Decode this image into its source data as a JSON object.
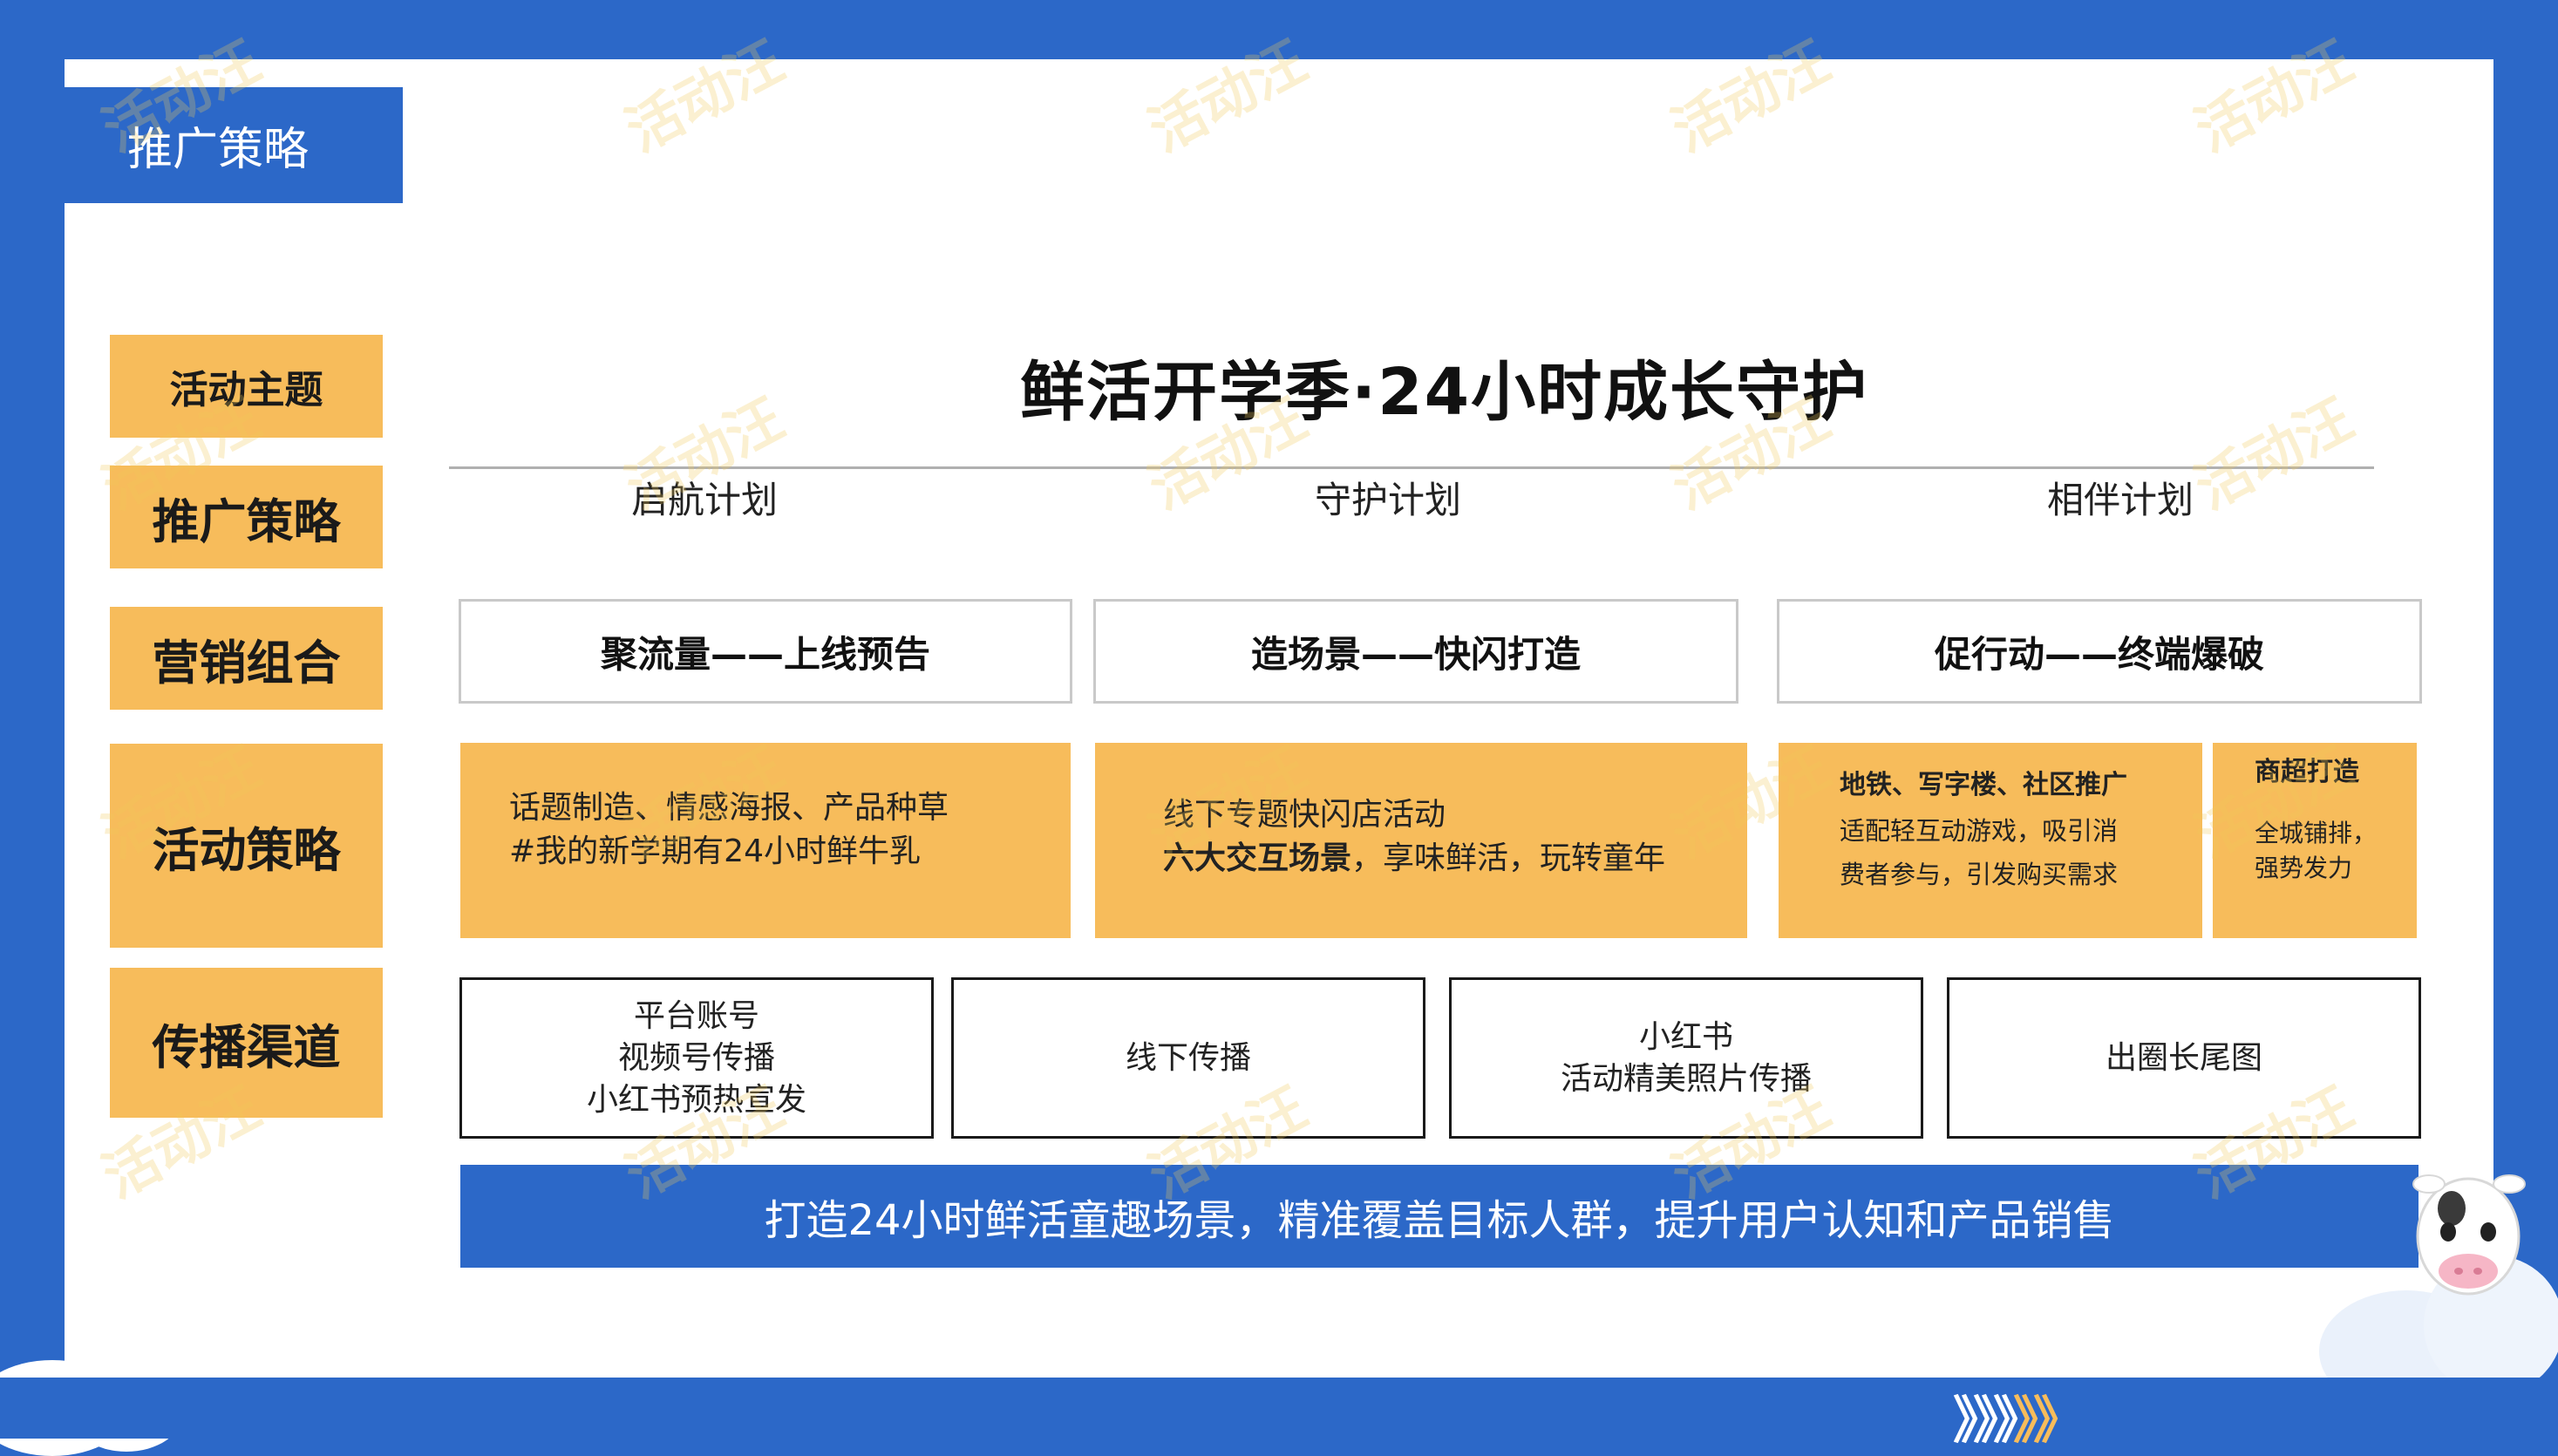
{
  "header": {
    "title": "推广策略"
  },
  "side_labels": [
    "活动主题",
    "推广策略",
    "营销组合",
    "活动策略",
    "传播渠道"
  ],
  "theme": {
    "title": "鲜活开学季·24小时成长守护"
  },
  "plans": [
    "启航计划",
    "守护计划",
    "相伴计划"
  ],
  "marketing": [
    "聚流量——上线预告",
    "造场景——快闪打造",
    "促行动——终端爆破"
  ],
  "activities": {
    "a1": {
      "line1": "话题制造、情感海报、产品种草",
      "line2": "#我的新学期有24小时鲜牛乳"
    },
    "a2": {
      "line1": "线下专题快闪店活动",
      "line2_bold": "六大交互场景",
      "line2_rest": "，享味鲜活，玩转童年"
    },
    "a3": {
      "title": "地铁、写字楼、社区推广",
      "line1": "适配轻互动游戏，吸引消",
      "line2": "费者参与，引发购买需求"
    },
    "a4": {
      "title": "商超打造",
      "line1": "全城铺排，",
      "line2": "强势发力"
    }
  },
  "channels": {
    "c1": [
      "平台账号",
      "视频号传播",
      "小红书预热宣发"
    ],
    "c2": [
      "线下传播"
    ],
    "c3": [
      "小红书",
      "活动精美照片传播"
    ],
    "c4": [
      "出圈长尾图"
    ]
  },
  "banner": {
    "text": "打造24小时鲜活童趣场景，精准覆盖目标人群，提升用户认知和产品销售"
  },
  "decor": {
    "chevrons": "》》》》》",
    "watermark": "活动汪",
    "colors": {
      "blue": "#2c68c8",
      "orange": "#f7bc5b",
      "white": "#ffffff"
    }
  }
}
